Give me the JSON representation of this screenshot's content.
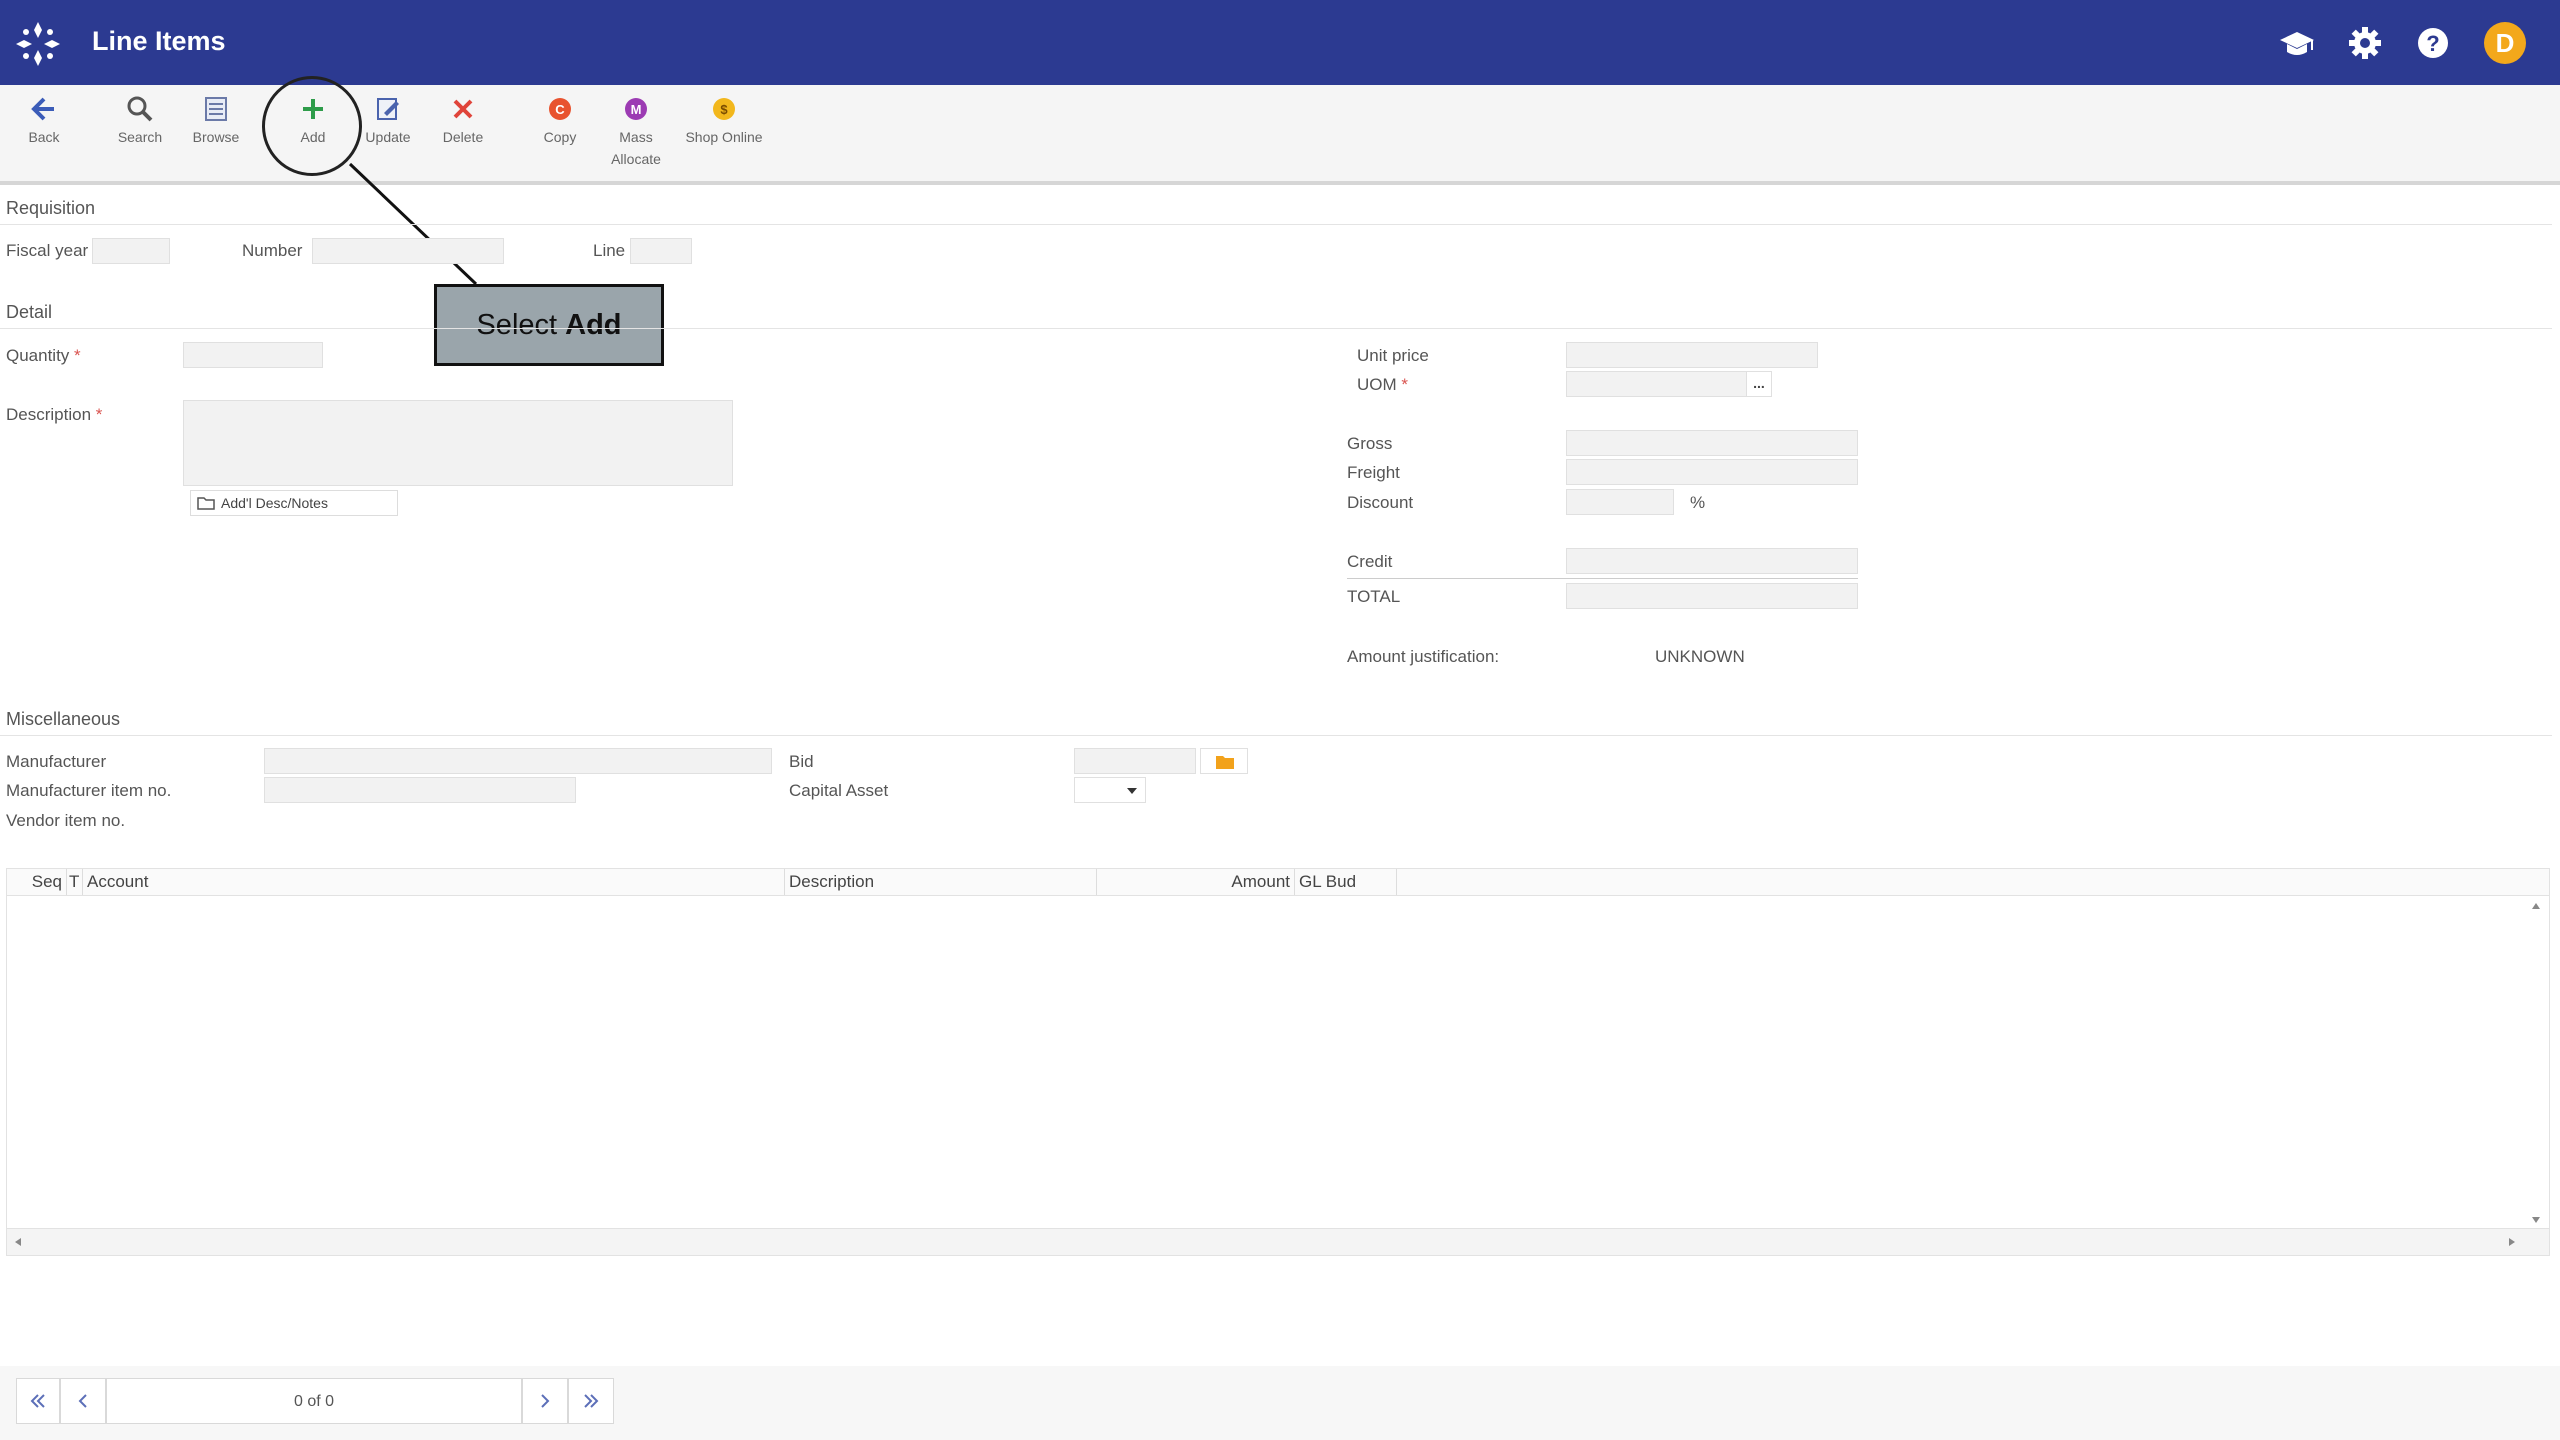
{
  "header": {
    "title": "Line Items",
    "avatar_initial": "D"
  },
  "toolbar": {
    "back": "Back",
    "search": "Search",
    "browse": "Browse",
    "add": "Add",
    "update": "Update",
    "delete": "Delete",
    "copy": "Copy",
    "mass_allocate_1": "Mass",
    "mass_allocate_2": "Allocate",
    "shop_online": "Shop Online"
  },
  "requisition": {
    "title": "Requisition",
    "fiscal_year": "Fiscal year",
    "number": "Number",
    "line": "Line"
  },
  "detail": {
    "title": "Detail",
    "quantity": "Quantity",
    "description": "Description",
    "addl_notes": "Add'l Desc/Notes",
    "required_mark": "*",
    "unit_price": "Unit price",
    "uom": "UOM",
    "uom_btn": "...",
    "gross": "Gross",
    "freight": "Freight",
    "discount": "Discount",
    "percent": "%",
    "credit": "Credit",
    "total": "TOTAL",
    "amount_justification": "Amount justification:",
    "amount_justification_value": "UNKNOWN"
  },
  "misc": {
    "title": "Miscellaneous",
    "manufacturer": "Manufacturer",
    "manufacturer_item_no": "Manufacturer item no.",
    "vendor_item_no": "Vendor item no.",
    "bid": "Bid",
    "capital_asset": "Capital Asset"
  },
  "grid": {
    "columns": [
      "Seq",
      "T",
      "Account",
      "Description",
      "Amount",
      "GL Bud"
    ]
  },
  "pager": {
    "count": "0 of 0"
  },
  "callout": {
    "prefix": "Select ",
    "bold": "Add"
  },
  "colors": {
    "header_bg": "#2c3a91",
    "avatar": "#f3a81b",
    "add_icon": "#2e9c4a",
    "delete_icon": "#e0443a"
  }
}
